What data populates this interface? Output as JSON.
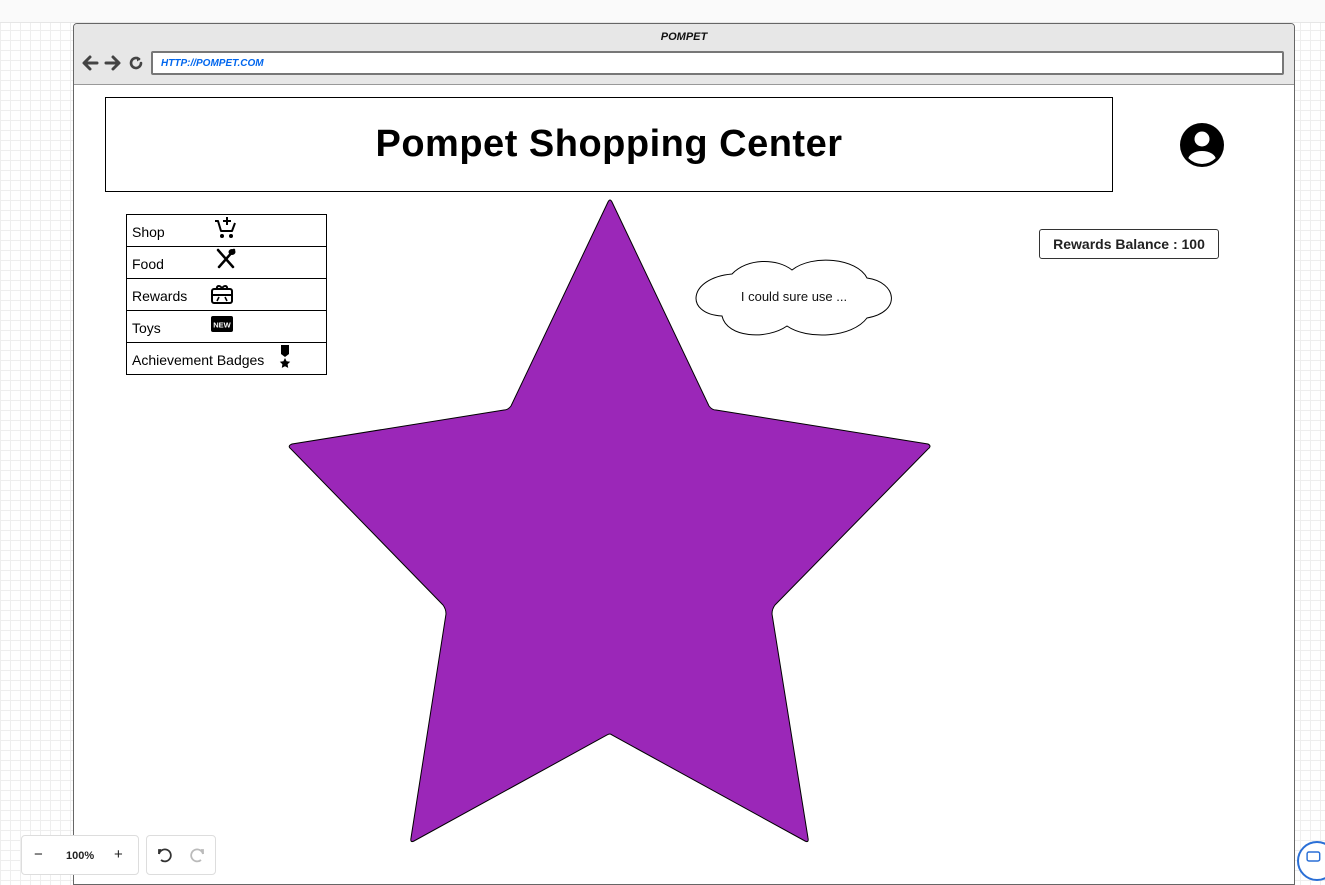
{
  "window": {
    "title": "POMPET"
  },
  "address_bar": {
    "url": "HTTP://POMPET.COM"
  },
  "header": {
    "title": "Pompet Shopping Center"
  },
  "menu": {
    "items": [
      {
        "label": "Shop",
        "icon": "cart-plus-icon"
      },
      {
        "label": "Food",
        "icon": "utensils-icon"
      },
      {
        "label": "Rewards",
        "icon": "gift-card-icon"
      },
      {
        "label": "Toys",
        "icon": "new-badge-icon"
      },
      {
        "label": "Achievement Badges",
        "icon": "medal-icon"
      }
    ]
  },
  "rewards": {
    "label": "Rewards Balance : 100"
  },
  "speech_cloud": {
    "text": "I could sure use ..."
  },
  "star": {
    "fill": "#9b27b8"
  },
  "toolbar": {
    "zoom_out": "−",
    "zoom_level": "100%",
    "zoom_in": "+"
  },
  "icons": {
    "back": "arrow-left-icon",
    "forward": "arrow-right-icon",
    "refresh": "refresh-icon",
    "avatar": "user-circle-icon"
  }
}
